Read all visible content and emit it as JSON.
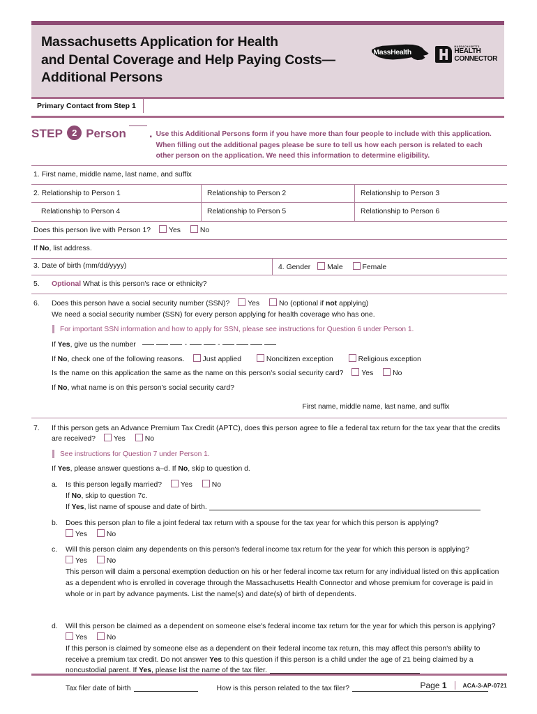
{
  "header": {
    "title": "Massachusetts Application for Health\nand Dental Coverage and Help Paying Costs—\nAdditional Persons",
    "masshealth_logo_text": "MassHealth",
    "connector_logo_top": "MASSACHUSETTS",
    "connector_logo_line1": "HEALTH",
    "connector_logo_line2": "CONNECTOR",
    "primary_contact_label": "Primary Contact from Step 1",
    "primary_contact_value": ""
  },
  "step": {
    "step_word": "STEP",
    "step_number": "2",
    "person_word": "Person",
    "period": ".",
    "instructions": "Use this Additional Persons form if you have more than four people to include with this application. When filling out the additional pages please be sure to tell us how each person is related to each other person on the application. We need this information to determine eligibility."
  },
  "q1": {
    "number": "1.",
    "label": "First name, middle name, last name, and suffix"
  },
  "q2": {
    "number": "2.",
    "rel1": "Relationship to Person 1",
    "rel2": "Relationship to Person 2",
    "rel3": "Relationship to Person 3",
    "rel4": "Relationship to Person 4",
    "rel5": "Relationship to Person 5",
    "rel6": "Relationship to Person 6"
  },
  "live_with": {
    "question": "Does this person live with Person 1?",
    "yes": "Yes",
    "no": "No",
    "if_no": "If <b>No</b>, list address."
  },
  "q3": {
    "number": "3.",
    "label": "Date of birth (mm/dd/yyyy)"
  },
  "q4": {
    "number": "4.",
    "label": "Gender",
    "male": "Male",
    "female": "Female"
  },
  "q5": {
    "number": "5.",
    "optional": "Optional",
    "label": "What is this person's race or ethnicity?"
  },
  "q6": {
    "number": "6.",
    "question": "Does this person have a social security number (SSN)?",
    "yes": "Yes",
    "no_optional": "No (optional if <b>not</b> applying)",
    "subtext": "We need a social security number (SSN) for every person applying for health coverage who has one.",
    "note": "For important SSN information and how to apply for SSN, please see instructions for Question 6 under Person 1.",
    "if_yes": "If <b>Yes</b>, give us the number",
    "if_no_reasons": "If <b>No</b>, check one of the following reasons.",
    "reason_just_applied": "Just applied",
    "reason_noncitizen": "Noncitizen exception",
    "reason_religious": "Religious exception",
    "same_name_q": "Is the name on this application the same as the name on this person's social security card?",
    "same_name_yes": "Yes",
    "same_name_no": "No",
    "if_no_name": "If <b>No</b>, what name is on this person's social security card?",
    "name_caption": "First name, middle name, last name, and suffix"
  },
  "q7": {
    "number": "7.",
    "question": "If this person gets an Advance Premium Tax Credit (APTC), does this person agree to file a federal tax return for the tax year that the credits are received?",
    "yes": "Yes",
    "no": "No",
    "note": "See instructions for Question 7 under Person 1.",
    "branch": "If <b>Yes</b>, please answer questions a–d. If <b>No</b>, skip to question d.",
    "a": {
      "letter": "a.",
      "question": "Is this person legally married?",
      "yes": "Yes",
      "no": "No",
      "if_no": "If <b>No</b>, skip to question 7c.",
      "if_yes": "If <b>Yes</b>, list name of spouse and date of birth."
    },
    "b": {
      "letter": "b.",
      "question": "Does this person plan to file a joint federal tax return with a spouse for the tax year for which this person is applying?",
      "yes": "Yes",
      "no": "No"
    },
    "c": {
      "letter": "c.",
      "question": "Will this person claim any dependents on this person's federal income tax return for the year for which this person is applying?",
      "yes": "Yes",
      "no": "No",
      "detail": "This person will claim a personal exemption deduction on his or her federal income tax return for any individual listed on this application as a dependent who is enrolled in coverage through the Massachusetts Health Connector and whose premium for coverage is paid in whole or in part by advance payments. List the name(s) and date(s) of birth of dependents."
    },
    "d": {
      "letter": "d.",
      "question": "Will this person be claimed as a dependent on someone else's federal income tax return for the year for which this person is applying?",
      "yes": "Yes",
      "no": "No",
      "detail": "If this person is claimed by someone else as a dependent on their federal income tax return, this may affect this person's ability to receive a premium tax credit. Do not answer <b>Yes</b> to this question if this person is a child under the age of 21 being claimed by a noncustodial parent. If <b>Yes</b>, please list the name of the tax filer.",
      "dob_label": "Tax filer date of birth",
      "relation_label": "How is this person related to the tax filer?"
    }
  },
  "footer": {
    "page_word": "Page",
    "page_number": "1",
    "form_number": "ACA-3-AP-0721"
  },
  "colors": {
    "accent": "#8e4b74",
    "rule": "#b07f9b",
    "band": "#e2d5dc",
    "note": "#a2547f"
  }
}
